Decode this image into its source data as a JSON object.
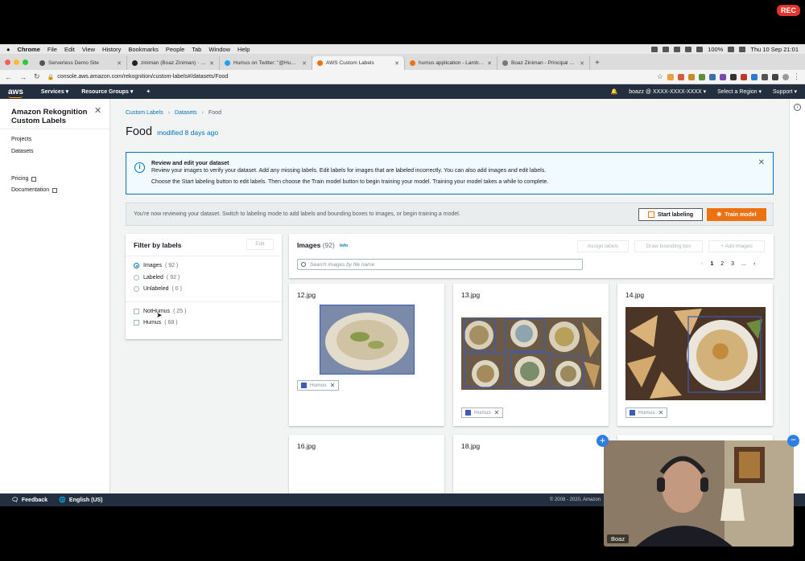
{
  "recording": {
    "label": "REC"
  },
  "menubar": {
    "items": [
      "Chrome",
      "File",
      "Edit",
      "View",
      "History",
      "Bookmarks",
      "People",
      "Tab",
      "Window",
      "Help"
    ],
    "battery": "100%",
    "clock": "Thu 10 Sep 21:01"
  },
  "tabs": [
    {
      "title": "Serverless Demo Site",
      "favicon_color": "#555555"
    },
    {
      "title": "ziniman (Boaz Ziniman) · GitH",
      "favicon_color": "#222222"
    },
    {
      "title": "Humus on Twitter: \"@Humus",
      "favicon_color": "#1da1f2"
    },
    {
      "title": "AWS Custom Labels",
      "favicon_color": "#ec7211"
    },
    {
      "title": "humus application - Lambda",
      "favicon_color": "#ec7211"
    },
    {
      "title": "Boaz Ziniman - Principal Deve",
      "favicon_color": "#777777"
    }
  ],
  "address": {
    "url": "console.aws.amazon.com/rekognition/custom-labels#/datasets/Food"
  },
  "awsnav": {
    "logo": "aws",
    "services": "Services",
    "resource_groups": "Resource Groups",
    "account": "boazz @ XXXX-XXXX-XXXX",
    "region": "Select a Region",
    "support": "Support"
  },
  "sidebar": {
    "title": "Amazon Rekognition Custom Labels",
    "links": [
      "Projects",
      "Datasets"
    ],
    "external_links": [
      "Pricing",
      "Documentation"
    ]
  },
  "breadcrumbs": [
    "Custom Labels",
    "Datasets",
    "Food"
  ],
  "page": {
    "title": "Food",
    "subtitle": "modified 8 days ago"
  },
  "info_alert": {
    "heading": "Review and edit your dataset",
    "line1": "Review your images to verify your dataset. Add any missing labels. Edit labels for images that are labeled incorrectly. You can also add images and edit labels.",
    "line2": "Choose the Start labeling button to edit labels. Then choose the Train model button to begin training your model. Training your model takes a while to complete."
  },
  "review_bar": {
    "message": "You're now reviewing your dataset. Switch to labeling mode to add labels and bounding boxes to images, or begin training a model.",
    "start_labeling": "Start labeling",
    "train_model": "Train model"
  },
  "filter": {
    "title": "Filter by labels",
    "edit": "Edit",
    "options": [
      {
        "label": "Images",
        "count": "( 92 )",
        "selected": true
      },
      {
        "label": "Labeled",
        "count": "( 92 )",
        "selected": false
      },
      {
        "label": "Unlabeled",
        "count": "( 0 )",
        "selected": false
      }
    ],
    "labels": [
      {
        "label": "NotHumus",
        "count": "( 25 )"
      },
      {
        "label": "Humus",
        "count": "( 68 )"
      }
    ]
  },
  "images_panel": {
    "title": "Images",
    "count": "(92)",
    "info": "Info",
    "assign_labels": "Assign labels",
    "draw_bounding_box": "Draw bounding box",
    "add_images": "Add images",
    "search_placeholder": "Search images by file name",
    "pages": [
      "1",
      "2",
      "3",
      "..."
    ]
  },
  "cards": [
    {
      "file": "12.jpg",
      "label": "Humus"
    },
    {
      "file": "13.jpg",
      "label": "Humus"
    },
    {
      "file": "14.jpg",
      "label": "Humus"
    },
    {
      "file": "16.jpg"
    },
    {
      "file": "18.jpg"
    }
  ],
  "footer": {
    "feedback": "Feedback",
    "language": "English (US)",
    "copyright": "© 2008 - 2020, Amazon"
  },
  "webcam": {
    "name": "Boaz"
  },
  "colors": {
    "aws_orange": "#ec7211",
    "aws_dark": "#232f3e",
    "link_blue": "#0073bb",
    "label_swatch": "#3d5bb5"
  }
}
